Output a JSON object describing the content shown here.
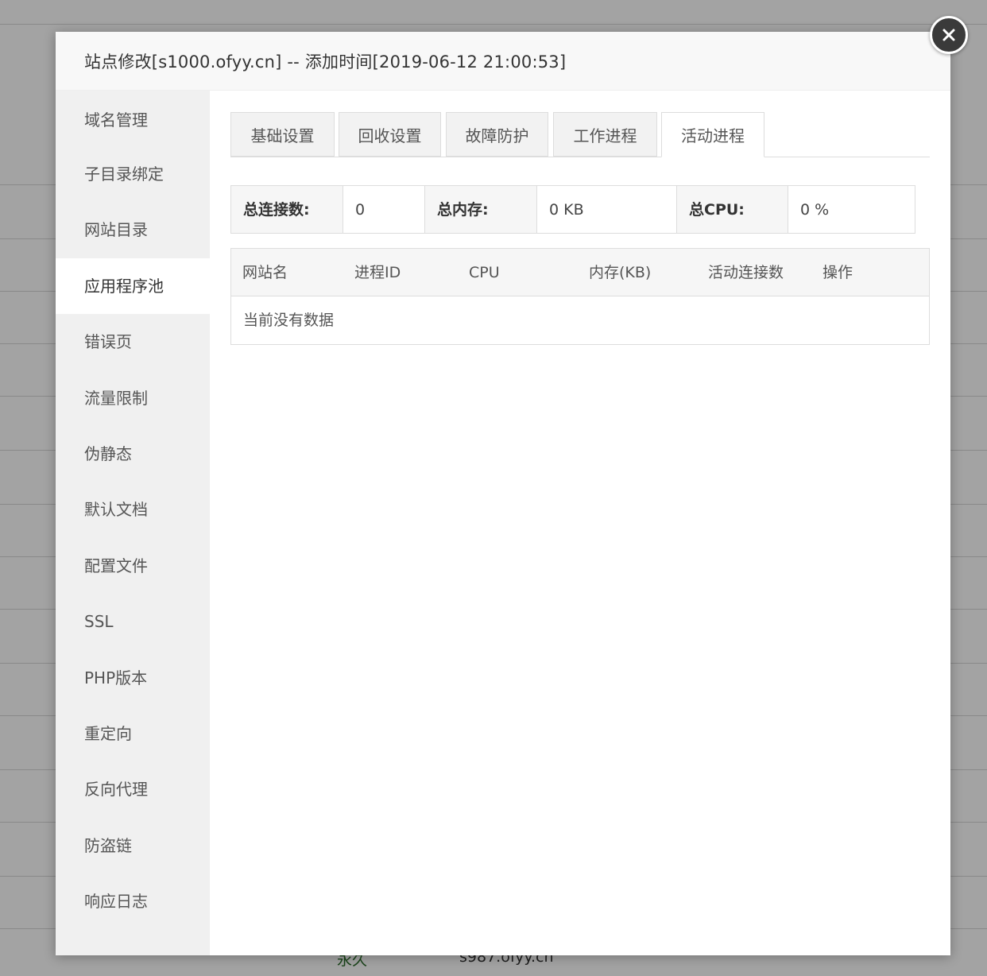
{
  "modal": {
    "title": "站点修改[s1000.ofyy.cn] -- 添加时间[2019-06-12 21:00:53]"
  },
  "background": {
    "row_text": "永久",
    "row_url": "s987.ofyy.cn"
  },
  "sidebar": {
    "items": [
      {
        "label": "域名管理"
      },
      {
        "label": "子目录绑定"
      },
      {
        "label": "网站目录"
      },
      {
        "label": "应用程序池",
        "active": true
      },
      {
        "label": "错误页"
      },
      {
        "label": "流量限制"
      },
      {
        "label": "伪静态"
      },
      {
        "label": "默认文档"
      },
      {
        "label": "配置文件"
      },
      {
        "label": "SSL"
      },
      {
        "label": "PHP版本"
      },
      {
        "label": "重定向"
      },
      {
        "label": "反向代理"
      },
      {
        "label": "防盗链"
      },
      {
        "label": "响应日志"
      }
    ]
  },
  "tabs": [
    {
      "label": "基础设置"
    },
    {
      "label": "回收设置"
    },
    {
      "label": "故障防护"
    },
    {
      "label": "工作进程"
    },
    {
      "label": "活动进程",
      "active": true
    }
  ],
  "stats": {
    "total_connections_label": "总连接数:",
    "total_connections_value": "0",
    "total_memory_label": "总内存:",
    "total_memory_value": "0 KB",
    "total_cpu_label": "总CPU:",
    "total_cpu_value": "0 %"
  },
  "process_table": {
    "columns": [
      "网站名",
      "进程ID",
      "CPU",
      "内存(KB)",
      "活动连接数",
      "操作"
    ],
    "empty_text": "当前没有数据"
  },
  "colors": {
    "overlay": "#000000",
    "sidebar_bg": "#f0f0f0",
    "header_bg": "#f8f8f8",
    "close_button": "#3a3a3a"
  },
  "icons": {
    "close": "close-icon"
  }
}
